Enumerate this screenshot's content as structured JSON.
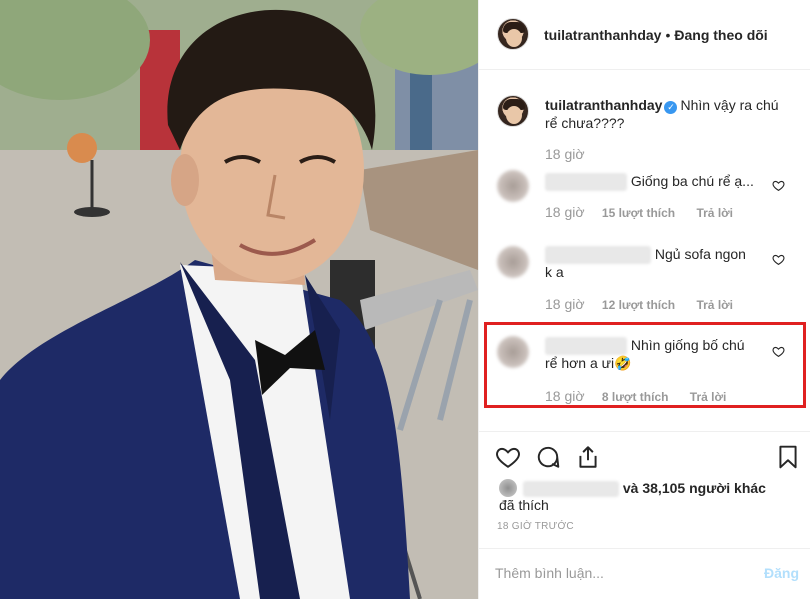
{
  "post": {
    "author": "tuilatranthanhday",
    "follow_status": "Đang theo dõi"
  },
  "caption": {
    "username": "tuilatranthanhday",
    "text_line1": "Nhìn vậy ra chú",
    "text_line2": "rể chưa????",
    "time": "18 giờ"
  },
  "comments": [
    {
      "text_line1": "Giống ba chú rể ạ...",
      "text_line2": "",
      "time": "18 giờ",
      "likes": "15 lượt thích",
      "reply": "Trả lời"
    },
    {
      "text_line1": "Ngủ sofa ngon",
      "text_line2": "k a",
      "time": "18 giờ",
      "likes": "12 lượt thích",
      "reply": "Trả lời"
    },
    {
      "text_line1": "Nhìn giống bố chú",
      "text_line2": "rể hơn a ưi🤣",
      "time": "18 giờ",
      "likes": "8 lượt thích",
      "reply": "Trả lời"
    }
  ],
  "icons": {
    "like": "heart-icon",
    "comment": "comment-icon",
    "share": "share-icon",
    "save": "bookmark-icon"
  },
  "likes_summary": {
    "count_text": "và 38,105 người khác",
    "liked_text": "đã thích"
  },
  "timestamp": "18 GIỜ TRƯỚC",
  "add_comment": {
    "placeholder": "Thêm bình luận...",
    "post_label": "Đăng"
  },
  "colors": {
    "highlight_border": "#e02020",
    "verified_badge": "#3897f0",
    "post_button_disabled": "#b2dffc"
  }
}
